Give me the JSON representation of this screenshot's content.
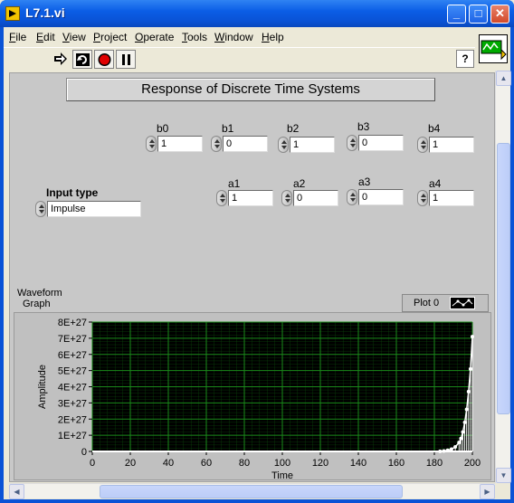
{
  "window": {
    "title": "L7.1.vi"
  },
  "title_buttons": {
    "minimize": "_",
    "maximize": "□",
    "close": "✕"
  },
  "menu": [
    "File",
    "Edit",
    "View",
    "Project",
    "Operate",
    "Tools",
    "Window",
    "Help"
  ],
  "toolbar": {
    "icons": [
      "run-arrow-icon",
      "run-continuously-icon",
      "abort-icon",
      "pause-icon"
    ],
    "help": "?"
  },
  "panel": {
    "heading": "Response of Discrete Time Systems",
    "b": [
      {
        "label": "b0",
        "value": "1"
      },
      {
        "label": "b1",
        "value": "0"
      },
      {
        "label": "b2",
        "value": "1"
      },
      {
        "label": "b3",
        "value": "0"
      },
      {
        "label": "b4",
        "value": "1"
      }
    ],
    "a": [
      {
        "label": "a1",
        "value": "1"
      },
      {
        "label": "a2",
        "value": "0"
      },
      {
        "label": "a3",
        "value": "0"
      },
      {
        "label": "a4",
        "value": "1"
      }
    ],
    "input_type": {
      "label": "Input type",
      "value": "Impulse"
    }
  },
  "graph": {
    "label_line1": "Waveform",
    "label_line2": "Graph",
    "legend": "Plot 0"
  },
  "chart_data": {
    "type": "line",
    "title": "",
    "xlabel": "Time",
    "ylabel": "Amplitude",
    "xlim": [
      0,
      200
    ],
    "ylim": [
      0,
      8e+27
    ],
    "x_ticks": [
      "0",
      "20",
      "40",
      "60",
      "80",
      "100",
      "120",
      "140",
      "160",
      "180",
      "200"
    ],
    "y_ticks": [
      "0",
      "1E+27",
      "2E+27",
      "3E+27",
      "4E+27",
      "5E+27",
      "6E+27",
      "7E+27",
      "8E+27"
    ],
    "grid": true,
    "background": "#000000",
    "grid_color": "#0f5f0f",
    "series": [
      {
        "color": "#ffffff",
        "x": [
          0,
          20,
          40,
          60,
          80,
          100,
          120,
          140,
          160,
          180,
          183,
          185,
          187,
          189,
          191,
          193,
          194,
          195,
          196,
          197,
          198,
          199,
          200
        ],
        "values": [
          0,
          0,
          0,
          0,
          0,
          0,
          0,
          0,
          0,
          0,
          1e+25,
          3e+25,
          7e+25,
          1.4e+26,
          2.8e+26,
          5.5e+26,
          8e+26,
          1.2e+27,
          1.8e+27,
          2.6e+27,
          3.7e+27,
          5.1e+27,
          7.1e+27
        ]
      }
    ]
  }
}
